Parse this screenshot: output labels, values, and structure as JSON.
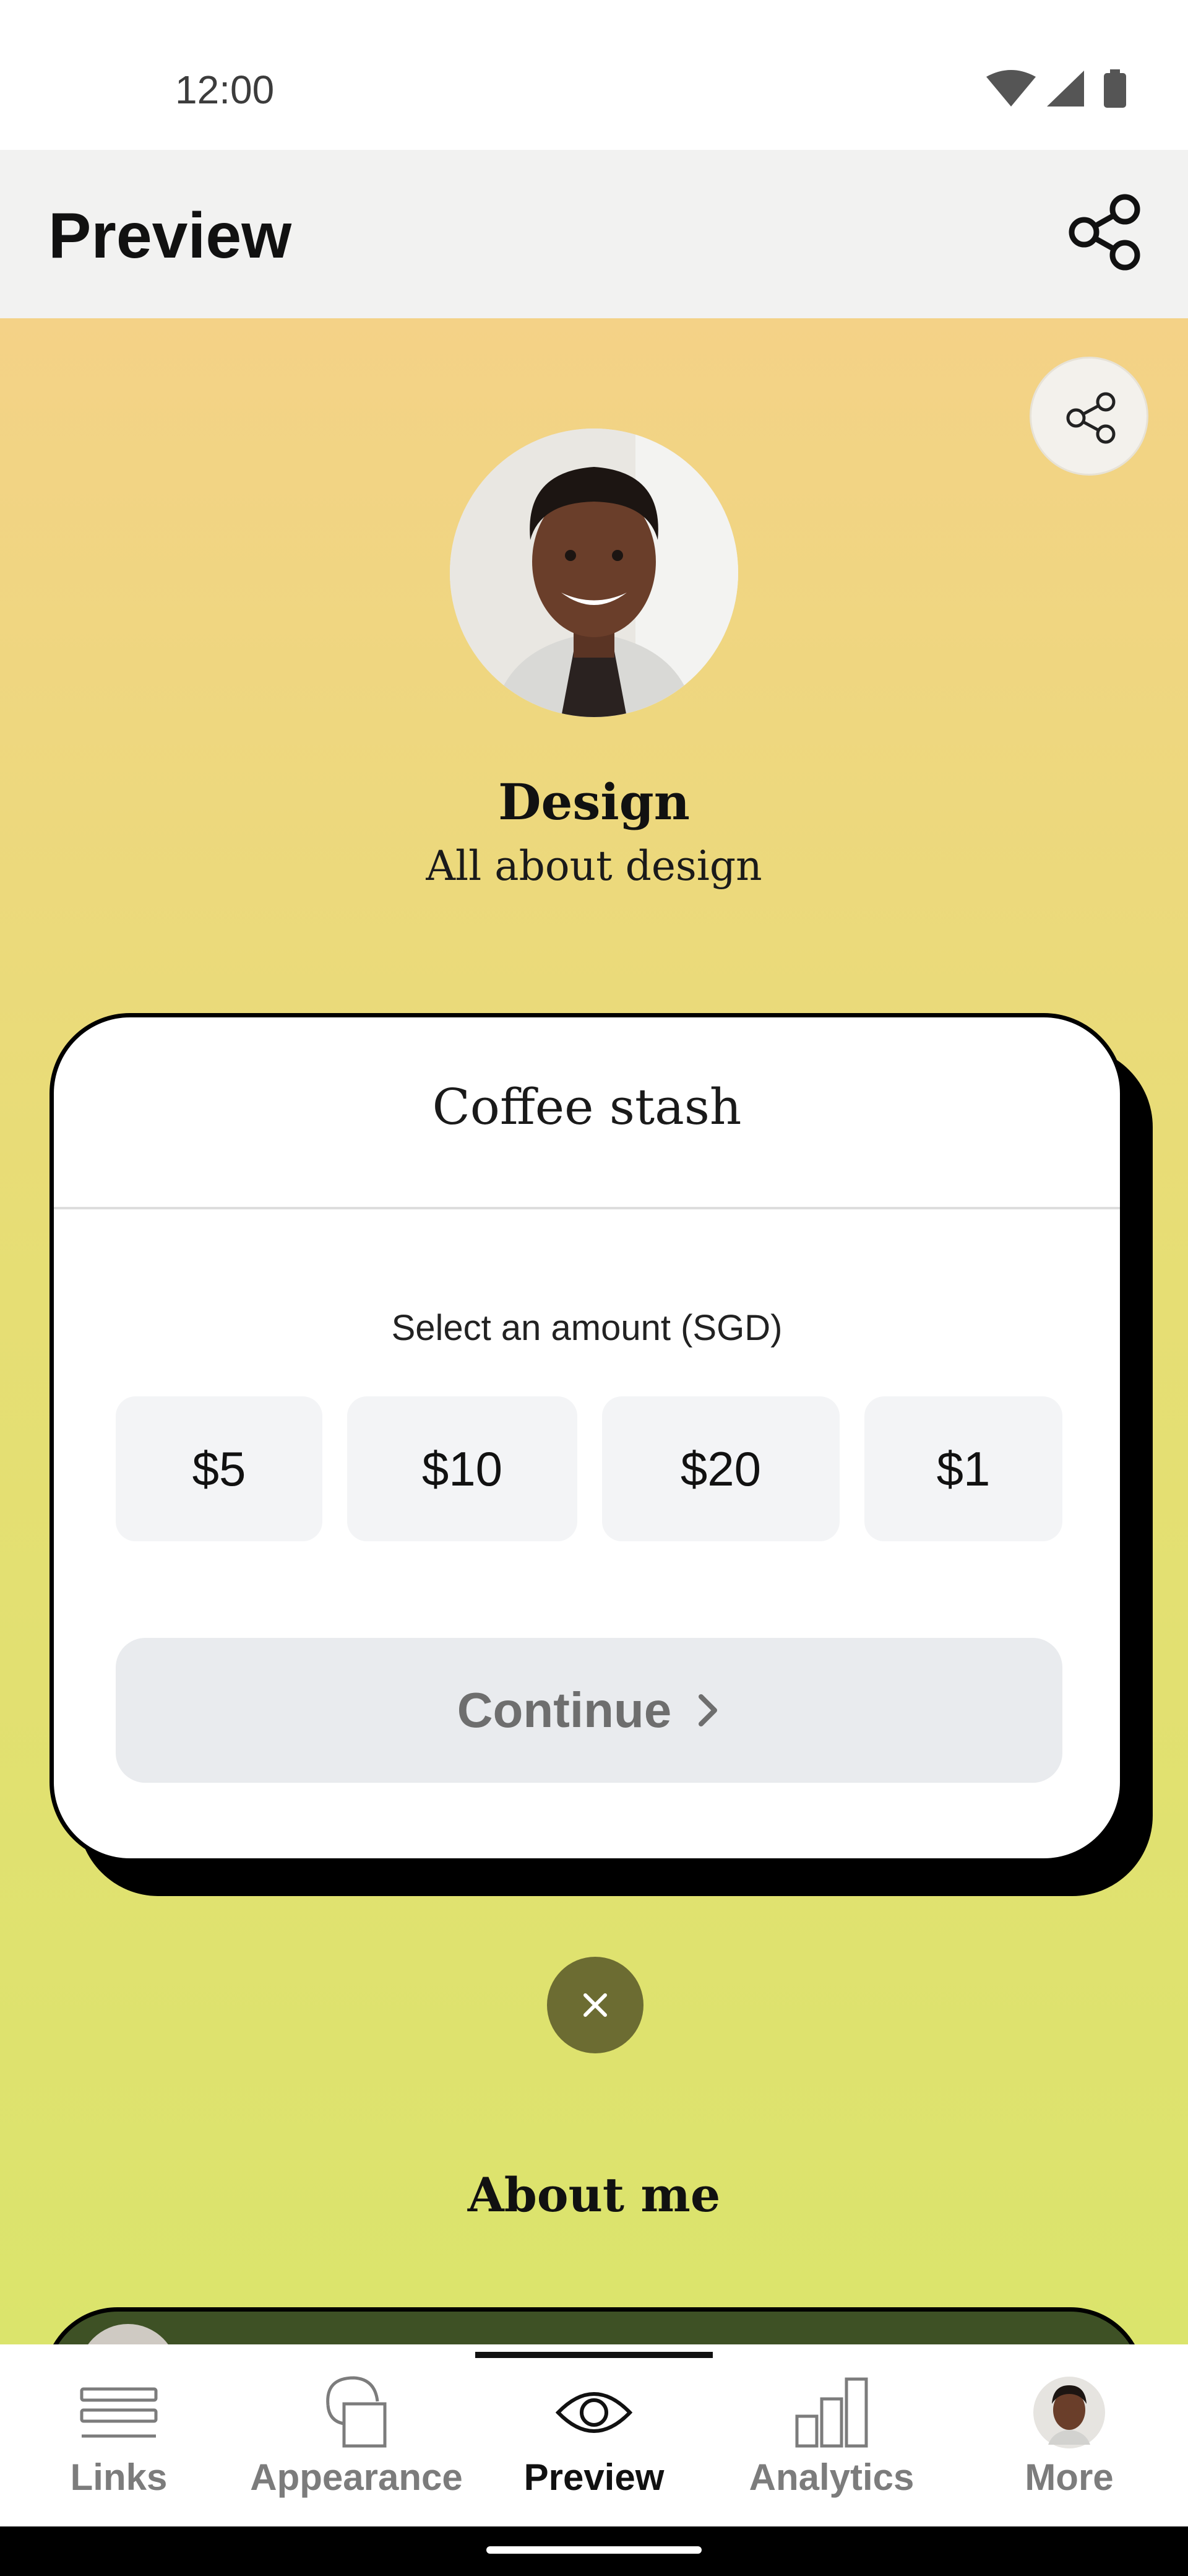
{
  "status_bar": {
    "time": "12:00",
    "icons": [
      "wifi-icon",
      "signal-icon",
      "battery-icon"
    ]
  },
  "app_bar": {
    "title": "Preview",
    "share_icon": "share-icon"
  },
  "profile": {
    "name": "Design",
    "bio": "All about design"
  },
  "tip_card": {
    "title": "Coffee stash",
    "amount_label": "Select an amount (SGD)",
    "amounts": [
      "$5",
      "$10",
      "$20",
      "$1"
    ],
    "continue_label": "Continue"
  },
  "about": {
    "title": "About me"
  },
  "nav": {
    "items": [
      {
        "label": "Links",
        "icon": "links-icon"
      },
      {
        "label": "Appearance",
        "icon": "appearance-icon"
      },
      {
        "label": "Preview",
        "icon": "eye-icon",
        "active": true
      },
      {
        "label": "Analytics",
        "icon": "analytics-icon"
      },
      {
        "label": "More",
        "icon": "avatar"
      }
    ]
  },
  "colors": {
    "background_top": "#f4d287",
    "background_bottom": "#dbe46c",
    "card_border": "#000000",
    "close_button": "#6c6c32",
    "about_card": "#3e5125"
  }
}
